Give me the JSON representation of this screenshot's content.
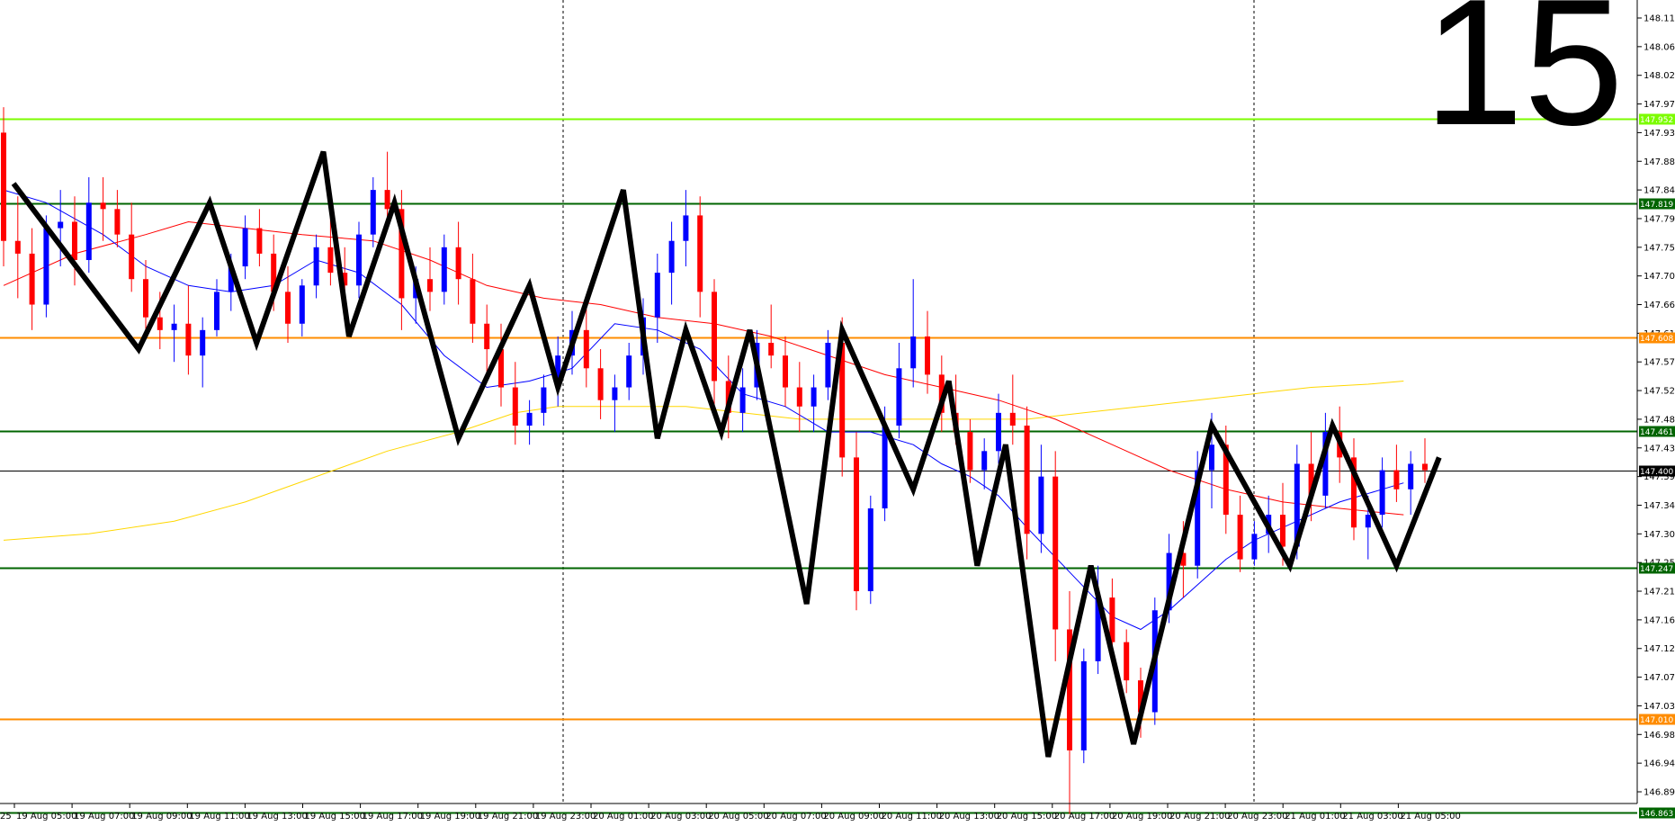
{
  "timeframe_number": "15",
  "chart_data": {
    "type": "candlestick",
    "ylim": [
      146.82,
      148.13
    ],
    "y_ticks": [
      "148.110",
      "148.065",
      "148.020",
      "147.975",
      "147.930",
      "147.885",
      "147.840",
      "147.795",
      "147.750",
      "147.705",
      "147.660",
      "147.615",
      "147.570",
      "147.525",
      "147.480",
      "147.435",
      "147.390",
      "147.345",
      "147.300",
      "147.255",
      "147.210",
      "147.165",
      "147.120",
      "147.075",
      "147.030",
      "146.985",
      "146.940",
      "146.895"
    ],
    "x_ticks": [
      "19 Aug 05:00",
      "19 Aug 07:00",
      "19 Aug 09:00",
      "19 Aug 11:00",
      "19 Aug 13:00",
      "19 Aug 15:00",
      "19 Aug 17:00",
      "19 Aug 19:00",
      "19 Aug 21:00",
      "19 Aug 23:00",
      "20 Aug 01:00",
      "20 Aug 03:00",
      "20 Aug 05:00",
      "20 Aug 07:00",
      "20 Aug 09:00",
      "20 Aug 11:00",
      "20 Aug 13:00",
      "20 Aug 15:00",
      "20 Aug 17:00",
      "20 Aug 19:00",
      "20 Aug 21:00",
      "20 Aug 23:00",
      "21 Aug 01:00",
      "21 Aug 03:00",
      "21 Aug 05:00"
    ],
    "x_tick_partial_left": "25",
    "levels": [
      {
        "value": 147.952,
        "label": "147.952",
        "color": "#7cfc00"
      },
      {
        "value": 147.819,
        "label": "147.819",
        "color": "#006400"
      },
      {
        "value": 147.608,
        "label": "147.608",
        "color": "#ff8c00"
      },
      {
        "value": 147.461,
        "label": "147.461",
        "color": "#006400"
      },
      {
        "value": 147.4,
        "label": "147.400",
        "color": "#000000"
      },
      {
        "value": 147.247,
        "label": "147.247",
        "color": "#006400"
      },
      {
        "value": 147.01,
        "label": "147.010",
        "color": "#ff8c00"
      },
      {
        "value": 146.863,
        "label": "146.863",
        "color": "#006400"
      }
    ],
    "bull_color": "#0000ff",
    "bear_color": "#ff0000",
    "ma_fast_color": "#0000ff",
    "ma_mid_color": "#ff0000",
    "ma_slow_color": "#ffd700",
    "zigzag_color": "#000000",
    "zigzag": [
      [
        0.7,
        147.85
      ],
      [
        9.5,
        147.59
      ],
      [
        14.5,
        147.82
      ],
      [
        17.8,
        147.6
      ],
      [
        22.5,
        147.9
      ],
      [
        24.3,
        147.61
      ],
      [
        27.5,
        147.82
      ],
      [
        32.0,
        147.45
      ],
      [
        37.0,
        147.69
      ],
      [
        39.0,
        147.53
      ],
      [
        43.6,
        147.84
      ],
      [
        46.0,
        147.45
      ],
      [
        48.0,
        147.62
      ],
      [
        50.5,
        147.46
      ],
      [
        52.5,
        147.62
      ],
      [
        56.5,
        147.19
      ],
      [
        59.0,
        147.62
      ],
      [
        64.0,
        147.37
      ],
      [
        66.5,
        147.54
      ],
      [
        68.5,
        147.25
      ],
      [
        70.5,
        147.44
      ],
      [
        73.5,
        146.95
      ],
      [
        76.5,
        147.25
      ],
      [
        79.5,
        146.97
      ],
      [
        85.0,
        147.47
      ],
      [
        90.5,
        147.25
      ],
      [
        93.5,
        147.47
      ],
      [
        98.0,
        147.25
      ],
      [
        101.0,
        147.42
      ]
    ],
    "ma_fast": [
      [
        0,
        147.84
      ],
      [
        3,
        147.82
      ],
      [
        7,
        147.77
      ],
      [
        10,
        147.72
      ],
      [
        13,
        147.69
      ],
      [
        16,
        147.68
      ],
      [
        19,
        147.69
      ],
      [
        22,
        147.73
      ],
      [
        25,
        147.71
      ],
      [
        28,
        147.66
      ],
      [
        31,
        147.58
      ],
      [
        34,
        147.53
      ],
      [
        37,
        147.54
      ],
      [
        40,
        147.56
      ],
      [
        43,
        147.63
      ],
      [
        46,
        147.62
      ],
      [
        49,
        147.59
      ],
      [
        52,
        147.52
      ],
      [
        55,
        147.5
      ],
      [
        58,
        147.46
      ],
      [
        61,
        147.46
      ],
      [
        64,
        147.44
      ],
      [
        66,
        147.41
      ],
      [
        68,
        147.39
      ],
      [
        70,
        147.36
      ],
      [
        72,
        147.31
      ],
      [
        75,
        147.24
      ],
      [
        78,
        147.17
      ],
      [
        80,
        147.15
      ],
      [
        82,
        147.18
      ],
      [
        84,
        147.22
      ],
      [
        86,
        147.26
      ],
      [
        88,
        147.29
      ],
      [
        91,
        147.32
      ],
      [
        94,
        147.35
      ],
      [
        97,
        147.37
      ],
      [
        98.5,
        147.38
      ]
    ],
    "ma_mid": [
      [
        0,
        147.69
      ],
      [
        5,
        147.74
      ],
      [
        10,
        147.77
      ],
      [
        13,
        147.79
      ],
      [
        17,
        147.78
      ],
      [
        21,
        147.77
      ],
      [
        26,
        147.76
      ],
      [
        30,
        147.73
      ],
      [
        34,
        147.69
      ],
      [
        38,
        147.67
      ],
      [
        42,
        147.66
      ],
      [
        46,
        147.64
      ],
      [
        50,
        147.63
      ],
      [
        54,
        147.61
      ],
      [
        58,
        147.58
      ],
      [
        62,
        147.55
      ],
      [
        66,
        147.53
      ],
      [
        70,
        147.51
      ],
      [
        74,
        147.48
      ],
      [
        78,
        147.44
      ],
      [
        82,
        147.4
      ],
      [
        86,
        147.37
      ],
      [
        90,
        147.35
      ],
      [
        94,
        147.34
      ],
      [
        98.5,
        147.33
      ]
    ],
    "ma_slow": [
      [
        0,
        147.29
      ],
      [
        6,
        147.3
      ],
      [
        12,
        147.32
      ],
      [
        17,
        147.35
      ],
      [
        22,
        147.39
      ],
      [
        27,
        147.43
      ],
      [
        32,
        147.46
      ],
      [
        36,
        147.49
      ],
      [
        39,
        147.5
      ],
      [
        44,
        147.5
      ],
      [
        48,
        147.5
      ],
      [
        52,
        147.49
      ],
      [
        56,
        147.48
      ],
      [
        60,
        147.48
      ],
      [
        64,
        147.48
      ],
      [
        68,
        147.48
      ],
      [
        72,
        147.48
      ],
      [
        76,
        147.49
      ],
      [
        80,
        147.5
      ],
      [
        84,
        147.51
      ],
      [
        88,
        147.52
      ],
      [
        92,
        147.53
      ],
      [
        96,
        147.535
      ],
      [
        98.5,
        147.54
      ]
    ],
    "candles": [
      [
        147.93,
        147.97,
        147.72,
        147.76
      ],
      [
        147.76,
        147.83,
        147.67,
        147.74
      ],
      [
        147.74,
        147.78,
        147.62,
        147.66
      ],
      [
        147.66,
        147.8,
        147.64,
        147.78
      ],
      [
        147.78,
        147.84,
        147.72,
        147.79
      ],
      [
        147.79,
        147.83,
        147.69,
        147.73
      ],
      [
        147.73,
        147.86,
        147.71,
        147.82
      ],
      [
        147.82,
        147.86,
        147.76,
        147.81
      ],
      [
        147.81,
        147.84,
        147.75,
        147.77
      ],
      [
        147.77,
        147.82,
        147.68,
        147.7
      ],
      [
        147.7,
        147.73,
        147.61,
        147.64
      ],
      [
        147.64,
        147.68,
        147.59,
        147.62
      ],
      [
        147.62,
        147.66,
        147.57,
        147.63
      ],
      [
        147.63,
        147.69,
        147.55,
        147.58
      ],
      [
        147.58,
        147.64,
        147.53,
        147.62
      ],
      [
        147.62,
        147.7,
        147.61,
        147.68
      ],
      [
        147.68,
        147.74,
        147.65,
        147.72
      ],
      [
        147.72,
        147.8,
        147.7,
        147.78
      ],
      [
        147.78,
        147.81,
        147.72,
        147.74
      ],
      [
        147.74,
        147.77,
        147.65,
        147.68
      ],
      [
        147.68,
        147.72,
        147.6,
        147.63
      ],
      [
        147.63,
        147.7,
        147.61,
        147.69
      ],
      [
        147.69,
        147.77,
        147.67,
        147.75
      ],
      [
        147.75,
        147.82,
        147.69,
        147.71
      ],
      [
        147.71,
        147.75,
        147.64,
        147.69
      ],
      [
        147.69,
        147.79,
        147.67,
        147.77
      ],
      [
        147.77,
        147.86,
        147.75,
        147.84
      ],
      [
        147.84,
        147.9,
        147.79,
        147.81
      ],
      [
        147.81,
        147.84,
        147.62,
        147.67
      ],
      [
        147.67,
        147.72,
        147.63,
        147.7
      ],
      [
        147.7,
        147.75,
        147.65,
        147.68
      ],
      [
        147.68,
        147.77,
        147.66,
        147.75
      ],
      [
        147.75,
        147.79,
        147.66,
        147.7
      ],
      [
        147.7,
        147.74,
        147.6,
        147.63
      ],
      [
        147.63,
        147.66,
        147.55,
        147.59
      ],
      [
        147.59,
        147.63,
        147.5,
        147.53
      ],
      [
        147.53,
        147.57,
        147.44,
        147.47
      ],
      [
        147.47,
        147.51,
        147.44,
        147.49
      ],
      [
        147.49,
        147.55,
        147.47,
        147.53
      ],
      [
        147.53,
        147.61,
        147.5,
        147.58
      ],
      [
        147.58,
        147.65,
        147.55,
        147.62
      ],
      [
        147.62,
        147.66,
        147.53,
        147.56
      ],
      [
        147.56,
        147.59,
        147.48,
        147.51
      ],
      [
        147.51,
        147.55,
        147.46,
        147.53
      ],
      [
        147.53,
        147.6,
        147.51,
        147.58
      ],
      [
        147.58,
        147.67,
        147.55,
        147.64
      ],
      [
        147.64,
        147.74,
        147.6,
        147.71
      ],
      [
        147.71,
        147.79,
        147.66,
        147.76
      ],
      [
        147.76,
        147.84,
        147.72,
        147.8
      ],
      [
        147.8,
        147.83,
        147.64,
        147.68
      ],
      [
        147.68,
        147.7,
        147.5,
        147.54
      ],
      [
        147.54,
        147.58,
        147.45,
        147.49
      ],
      [
        147.49,
        147.56,
        147.46,
        147.53
      ],
      [
        147.53,
        147.62,
        147.51,
        147.6
      ],
      [
        147.6,
        147.66,
        147.56,
        147.58
      ],
      [
        147.58,
        147.61,
        147.5,
        147.53
      ],
      [
        147.53,
        147.57,
        147.46,
        147.5
      ],
      [
        147.5,
        147.55,
        147.46,
        147.53
      ],
      [
        147.53,
        147.62,
        147.51,
        147.6
      ],
      [
        147.6,
        147.64,
        147.39,
        147.42
      ],
      [
        147.42,
        147.46,
        147.18,
        147.21
      ],
      [
        147.21,
        147.36,
        147.19,
        147.34
      ],
      [
        147.34,
        147.5,
        147.32,
        147.47
      ],
      [
        147.47,
        147.6,
        147.45,
        147.56
      ],
      [
        147.56,
        147.7,
        147.53,
        147.61
      ],
      [
        147.61,
        147.65,
        147.52,
        147.55
      ],
      [
        147.55,
        147.58,
        147.46,
        147.49
      ],
      [
        147.49,
        147.55,
        147.44,
        147.46
      ],
      [
        147.46,
        147.48,
        147.38,
        147.4
      ],
      [
        147.4,
        147.45,
        147.37,
        147.43
      ],
      [
        147.43,
        147.52,
        147.41,
        147.49
      ],
      [
        147.49,
        147.55,
        147.44,
        147.47
      ],
      [
        147.47,
        147.5,
        147.26,
        147.3
      ],
      [
        147.3,
        147.44,
        147.27,
        147.39
      ],
      [
        147.39,
        147.43,
        147.1,
        147.15
      ],
      [
        147.15,
        147.21,
        146.86,
        146.96
      ],
      [
        146.96,
        147.12,
        146.94,
        147.1
      ],
      [
        147.1,
        147.25,
        147.08,
        147.2
      ],
      [
        147.2,
        147.23,
        147.1,
        147.13
      ],
      [
        147.13,
        147.15,
        147.05,
        147.07
      ],
      [
        147.07,
        147.09,
        146.98,
        147.02
      ],
      [
        147.02,
        147.2,
        147.0,
        147.18
      ],
      [
        147.18,
        147.3,
        147.16,
        147.27
      ],
      [
        147.27,
        147.32,
        147.2,
        147.25
      ],
      [
        147.25,
        147.43,
        147.23,
        147.4
      ],
      [
        147.4,
        147.49,
        147.34,
        147.44
      ],
      [
        147.44,
        147.47,
        147.3,
        147.33
      ],
      [
        147.33,
        147.36,
        147.24,
        147.26
      ],
      [
        147.26,
        147.32,
        147.25,
        147.3
      ],
      [
        147.3,
        147.36,
        147.27,
        147.33
      ],
      [
        147.33,
        147.38,
        147.25,
        147.28
      ],
      [
        147.28,
        147.44,
        147.26,
        147.41
      ],
      [
        147.41,
        147.46,
        147.32,
        147.36
      ],
      [
        147.36,
        147.49,
        147.34,
        147.46
      ],
      [
        147.46,
        147.5,
        147.38,
        147.42
      ],
      [
        147.42,
        147.45,
        147.29,
        147.31
      ],
      [
        147.31,
        147.36,
        147.26,
        147.33
      ],
      [
        147.33,
        147.42,
        147.31,
        147.4
      ],
      [
        147.4,
        147.44,
        147.35,
        147.37
      ],
      [
        147.37,
        147.43,
        147.33,
        147.41
      ],
      [
        147.41,
        147.45,
        147.38,
        147.4
      ]
    ]
  }
}
